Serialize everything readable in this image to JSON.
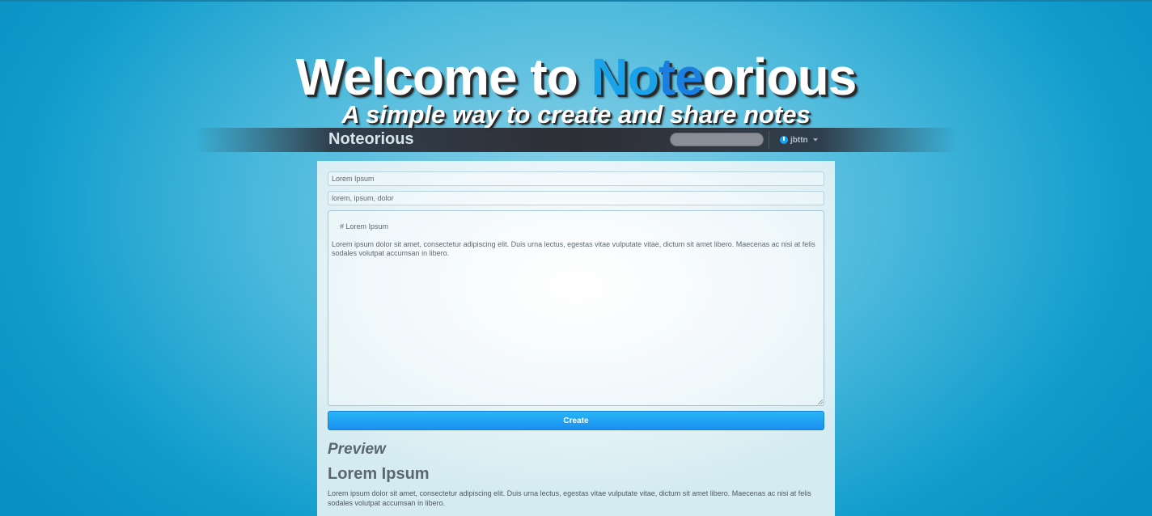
{
  "hero": {
    "title_prefix": "Welcome to ",
    "title_brand_part1": "No",
    "title_brand_part2": "te",
    "title_brand_rest": "orious",
    "subtitle": "A simple way to create and share notes"
  },
  "navbar": {
    "brand": "Noteorious",
    "user": "jbttn"
  },
  "form": {
    "title_value": "Lorem Ipsum",
    "tags_value": "lorem, ipsum, dolor",
    "body_value": "# Lorem Ipsum\n\nLorem ipsum dolor sit amet, consectetur adipiscing elit. Duis urna lectus, egestas vitae vulputate vitae, dictum sit amet libero. Maecenas ac nisi at felis sodales volutpat accumsan in libero.",
    "create_label": "Create"
  },
  "preview": {
    "heading": "Preview",
    "title": "Lorem Ipsum",
    "body": "Lorem ipsum dolor sit amet, consectetur adipiscing elit. Duis urna lectus, egestas vitae vulputate vitae, dictum sit amet libero. Maecenas ac nisi at felis sodales volutpat accumsan in libero."
  },
  "colors": {
    "accent": "#1aa3e8",
    "background": "#0f9ccc",
    "navbar": "#2e2e36"
  },
  "icons": {
    "user": "power-icon",
    "dropdown": "caret-down-icon"
  }
}
